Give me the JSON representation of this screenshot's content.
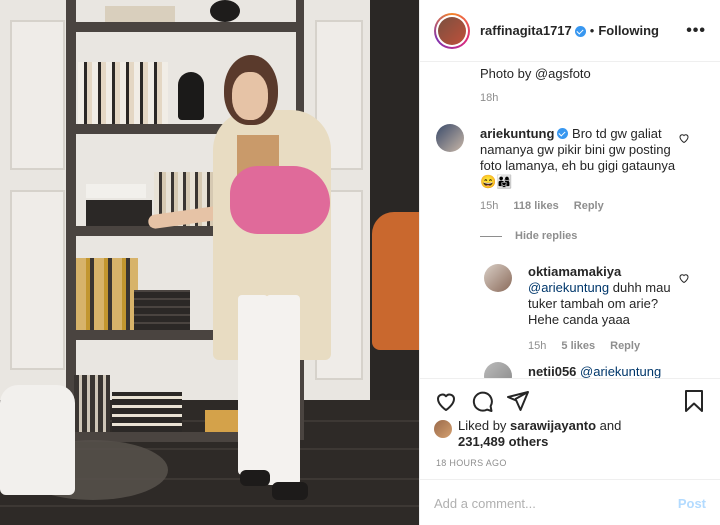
{
  "header": {
    "username": "raffinagita1717",
    "separator": "•",
    "follow_status": "Following",
    "more_icon": "more-horizontal-icon"
  },
  "caption": {
    "text": "Photo by @agsfoto",
    "time": "18h"
  },
  "comments": [
    {
      "username": "ariekuntung",
      "verified": true,
      "text": "Bro td gw galiat namanya gw pikir bini gw posting foto lamanya, eh bu gigi gataunya 😄👨‍👩‍👧",
      "time": "15h",
      "likes": "118 likes",
      "reply": "Reply"
    }
  ],
  "hide_replies": "Hide replies",
  "replies": [
    {
      "username": "oktiamamakiya",
      "mention": "@ariekuntung",
      "text": "duhh mau tuker tambah om arie? Hehe canda yaaa",
      "time": "15h",
      "likes": "5 likes",
      "reply": "Reply"
    },
    {
      "username": "netii056",
      "mention": "@ariekuntung"
    }
  ],
  "liked_by": {
    "prefix": "Liked by",
    "user": "sarawijayanto",
    "and": "and",
    "others": "231,489 others"
  },
  "timestamp": "18 HOURS AGO",
  "add_comment": {
    "placeholder": "Add a comment...",
    "post_label": "Post"
  },
  "colors": {
    "verified": "#3897f0",
    "mention": "#00376b",
    "post_disabled": "#b3dbff",
    "meta": "#8e8e8e"
  }
}
